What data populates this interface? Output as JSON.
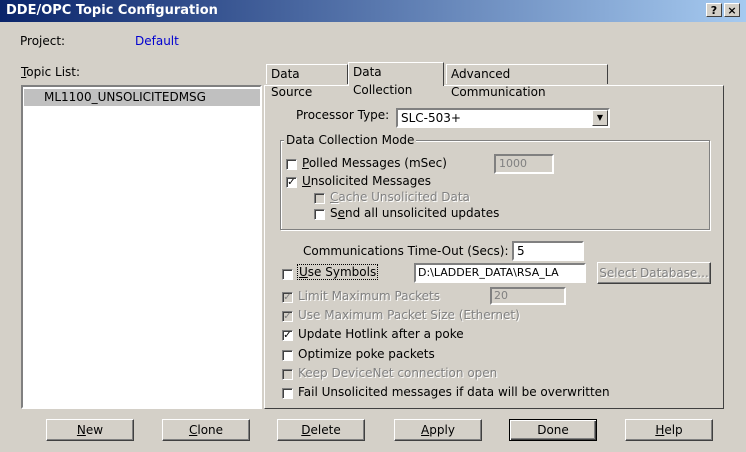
{
  "window": {
    "title": "DDE/OPC Topic Configuration",
    "help_btn": "?",
    "close_btn": "×"
  },
  "project": {
    "label": "Project:",
    "value": "Default"
  },
  "topic_list": {
    "label": "Topic List:",
    "items": [
      "ML1100_UNSOLICITEDMSG"
    ],
    "selected": "ML1100_UNSOLICITEDMSG"
  },
  "tabs": [
    "Data Source",
    "Data Collection",
    "Advanced Communication"
  ],
  "active_tab": "Data Collection",
  "processor": {
    "label": "Processor Type:",
    "value": "SLC-503+"
  },
  "collection_mode": {
    "legend": "Data Collection Mode",
    "polled_label": "Polled Messages (mSec)",
    "polled_checked": false,
    "polled_value": "1000",
    "unsolicited_label": "Unsolicited Messages",
    "unsolicited_checked": true,
    "cache_label": "Cache Unsolicited Data",
    "cache_checked": false,
    "sendall_label": "Send all unsolicited updates",
    "sendall_checked": false
  },
  "timeout": {
    "label": "Communications Time-Out (Secs):",
    "value": "5"
  },
  "symbols": {
    "label": "Use Symbols",
    "checked": false,
    "path": "D:\\LADDER_DATA\\RSA_LA",
    "select_db": "Select Database..."
  },
  "options": {
    "limit_packets_label": "Limit Maximum Packets",
    "limit_packets_value": "20",
    "max_packet_label": "Use Maximum Packet Size (Ethernet)",
    "hotlink_label": "Update Hotlink after a poke",
    "optimize_label": "Optimize poke packets",
    "devicenet_label": "Keep DeviceNet connection open",
    "fail_unsol_label": "Fail Unsolicited messages if data will be overwritten"
  },
  "buttons": {
    "new": "New",
    "clone": "Clone",
    "delete": "Delete",
    "apply": "Apply",
    "done": "Done",
    "help": "Help"
  }
}
